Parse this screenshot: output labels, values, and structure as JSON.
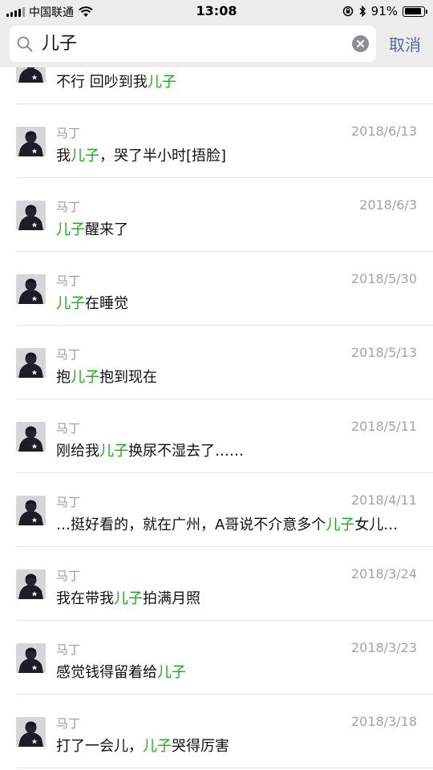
{
  "status_bar": {
    "carrier": "中国联通",
    "time": "13:08",
    "battery": "91%",
    "battery_level": 0.91
  },
  "search": {
    "query": "儿子",
    "cancel_label": "取消"
  },
  "colors": {
    "highlight": "#1aad19",
    "cancel": "#576b95",
    "meta_text": "#9a9a9a"
  },
  "results": [
    {
      "sender": "",
      "date": "",
      "parts": [
        {
          "text": "不行  回吵到我",
          "hl": false
        },
        {
          "text": "儿子",
          "hl": true
        }
      ]
    },
    {
      "sender": "马丁",
      "date": "2018/6/13",
      "parts": [
        {
          "text": "我",
          "hl": false
        },
        {
          "text": "儿子",
          "hl": true
        },
        {
          "text": "，哭了半小时[捂脸]",
          "hl": false
        }
      ]
    },
    {
      "sender": "马丁",
      "date": "2018/6/3",
      "parts": [
        {
          "text": "儿子",
          "hl": true
        },
        {
          "text": "醒来了",
          "hl": false
        }
      ]
    },
    {
      "sender": "马丁",
      "date": "2018/5/30",
      "parts": [
        {
          "text": "儿子",
          "hl": true
        },
        {
          "text": "在睡觉",
          "hl": false
        }
      ]
    },
    {
      "sender": "马丁",
      "date": "2018/5/13",
      "parts": [
        {
          "text": "抱",
          "hl": false
        },
        {
          "text": "儿子",
          "hl": true
        },
        {
          "text": "抱到现在",
          "hl": false
        }
      ]
    },
    {
      "sender": "马丁",
      "date": "2018/5/11",
      "parts": [
        {
          "text": "刚给我",
          "hl": false
        },
        {
          "text": "儿子",
          "hl": true
        },
        {
          "text": "换尿不湿去了……",
          "hl": false
        }
      ]
    },
    {
      "sender": "马丁",
      "date": "2018/4/11",
      "parts": [
        {
          "text": "…挺好看的，就在广州，A哥说不介意多个",
          "hl": false
        },
        {
          "text": "儿子",
          "hl": true
        },
        {
          "text": "女儿…",
          "hl": false
        }
      ]
    },
    {
      "sender": "马丁",
      "date": "2018/3/24",
      "parts": [
        {
          "text": "我在带我",
          "hl": false
        },
        {
          "text": "儿子",
          "hl": true
        },
        {
          "text": "拍满月照",
          "hl": false
        }
      ]
    },
    {
      "sender": "马丁",
      "date": "2018/3/23",
      "parts": [
        {
          "text": "感觉钱得留着给",
          "hl": false
        },
        {
          "text": "儿子",
          "hl": true
        }
      ]
    },
    {
      "sender": "马丁",
      "date": "2018/3/18",
      "parts": [
        {
          "text": "打了一会儿，",
          "hl": false
        },
        {
          "text": "儿子",
          "hl": true
        },
        {
          "text": "哭得厉害",
          "hl": false
        }
      ]
    }
  ]
}
